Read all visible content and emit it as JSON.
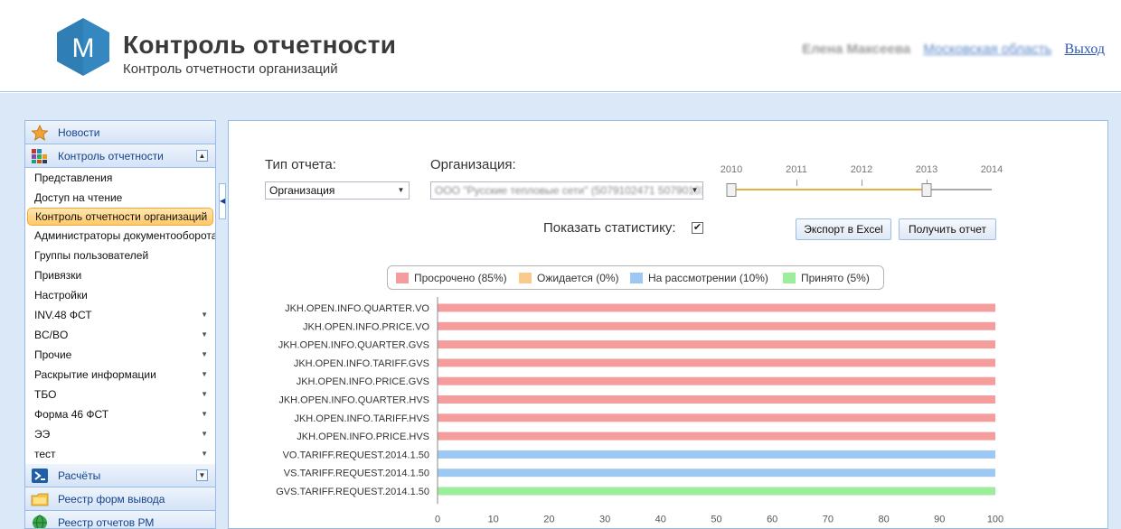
{
  "header": {
    "title": "Контроль отчетности",
    "subtitle": "Контроль отчетности организаций",
    "logo_letter": "М",
    "user_name": "Елена Максеева",
    "user_region": "Московская область",
    "logout_label": "Выход"
  },
  "sidebar": {
    "sections": [
      {
        "label": "Новости",
        "icon": "star-icon"
      },
      {
        "label": "Контроль отчетности",
        "icon": "report-blocks-icon",
        "expanded": true
      }
    ],
    "items": [
      {
        "label": "Представления"
      },
      {
        "label": "Доступ на чтение"
      },
      {
        "label": "Контроль отчетности организаций",
        "selected": true
      },
      {
        "label": "Администраторы документооборота"
      },
      {
        "label": "Группы пользователей"
      },
      {
        "label": "Привязки"
      },
      {
        "label": "Настройки"
      },
      {
        "label": "INV.48 ФСТ",
        "has_children": true
      },
      {
        "label": "BC/BO",
        "has_children": true
      },
      {
        "label": "Прочие",
        "has_children": true
      },
      {
        "label": "Раскрытие информации",
        "has_children": true
      },
      {
        "label": "ТБО",
        "has_children": true
      },
      {
        "label": "Форма 46 ФСТ",
        "has_children": true
      },
      {
        "label": "ЭЭ",
        "has_children": true
      },
      {
        "label": "тест",
        "has_children": true
      }
    ],
    "bottom_sections": [
      {
        "label": "Расчёты",
        "icon": "calculations-icon"
      },
      {
        "label": "Реестр форм вывода",
        "icon": "folder-icon"
      },
      {
        "label": "Реестр отчетов РМ",
        "icon": "globe-icon"
      }
    ]
  },
  "filters": {
    "report_type_label": "Тип отчета:",
    "report_type_value": "Организация",
    "organization_label": "Организация:",
    "organization_value": "ООО \"Русские тепловые сети\" (5079102471 50790101)",
    "years": [
      "2010",
      "2011",
      "2012",
      "2013",
      "2014"
    ],
    "selected_range": [
      "2010",
      "2013"
    ],
    "show_stats_label": "Показать статистику:",
    "show_stats_checked": true,
    "export_label": "Экспорт в Excel",
    "get_report_label": "Получить отчет"
  },
  "colors": {
    "overdue": "#f59c9c",
    "pending": "#f9c98d",
    "review": "#9dc8f4",
    "accepted": "#9cee9c",
    "brand": "#2f7fb5"
  },
  "chart_data": {
    "type": "bar",
    "orientation": "horizontal",
    "legend": [
      {
        "label": "Просрочено (85%)",
        "color": "#f59c9c"
      },
      {
        "label": "Ожидается (0%)",
        "color": "#f9c98d"
      },
      {
        "label": "На рассмотрении (10%)",
        "color": "#9dc8f4"
      },
      {
        "label": "Принято (5%)",
        "color": "#9cee9c"
      }
    ],
    "legend_position": "top",
    "categories": [
      "JKH.OPEN.INFO.QUARTER.VO",
      "JKH.OPEN.INFO.PRICE.VO",
      "JKH.OPEN.INFO.QUARTER.GVS",
      "JKH.OPEN.INFO.TARIFF.GVS",
      "JKH.OPEN.INFO.PRICE.GVS",
      "JKH.OPEN.INFO.QUARTER.HVS",
      "JKH.OPEN.INFO.TARIFF.HVS",
      "JKH.OPEN.INFO.PRICE.HVS",
      "VO.TARIFF.REQUEST.2014.1.50",
      "VS.TARIFF.REQUEST.2014.1.50",
      "GVS.TARIFF.REQUEST.2014.1.50"
    ],
    "values": [
      100,
      100,
      100,
      100,
      100,
      100,
      100,
      100,
      100,
      100,
      100
    ],
    "bar_status": [
      "overdue",
      "overdue",
      "overdue",
      "overdue",
      "overdue",
      "overdue",
      "overdue",
      "overdue",
      "review",
      "review",
      "accepted"
    ],
    "xticks": [
      0,
      10,
      20,
      30,
      40,
      50,
      60,
      70,
      80,
      90,
      100
    ],
    "xlim": [
      0,
      100
    ],
    "xlabel": "%",
    "grid": false
  }
}
